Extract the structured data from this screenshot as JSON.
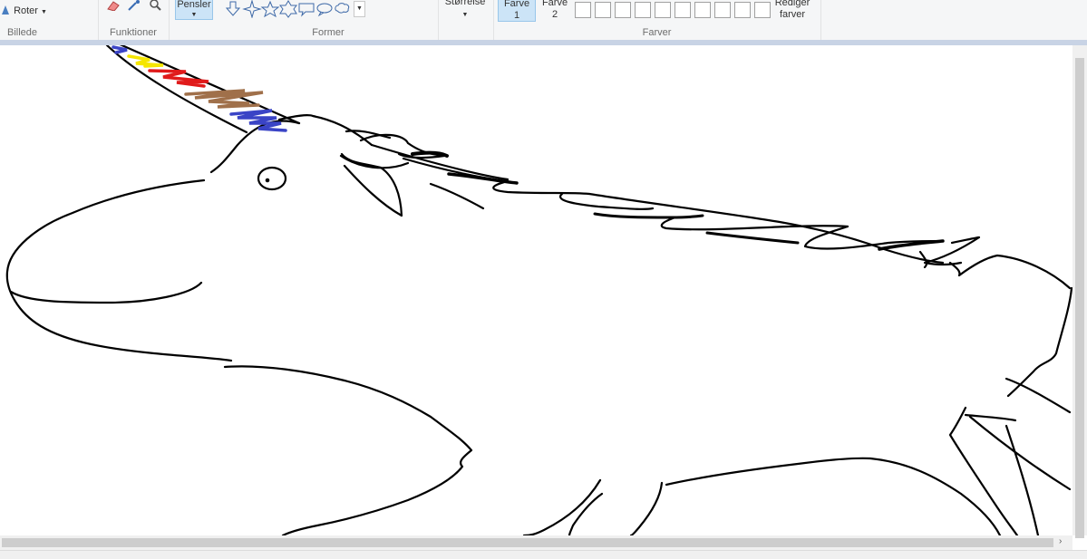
{
  "ribbon": {
    "image_group": {
      "rotate_label": "Roter",
      "label": "Billede"
    },
    "tools_group": {
      "label": "Funktioner",
      "icons": [
        "eraser-icon",
        "color-picker-icon",
        "magnifier-icon"
      ]
    },
    "brushes": {
      "label": "Pensler"
    },
    "shapes_group": {
      "label": "Former",
      "shapes": [
        "arrow-down",
        "star-four",
        "star-five",
        "star-six",
        "callout-rect",
        "callout-oval",
        "callout-cloud"
      ]
    },
    "size": {
      "label": "Størrelse"
    },
    "colors_group": {
      "label": "Farver",
      "color1": {
        "line1": "Farve",
        "line2": "1"
      },
      "color2": {
        "line1": "Farve",
        "line2": "2"
      },
      "edit": {
        "line1": "Rediger",
        "line2": "farver"
      },
      "custom_swatches": 10
    }
  },
  "colors": {
    "ink": "#000000",
    "yellow": "#f5e600",
    "red": "#e01b1b",
    "brown": "#a0704a",
    "blue": "#3a44c6",
    "selected_bg": "#cce4f7"
  }
}
